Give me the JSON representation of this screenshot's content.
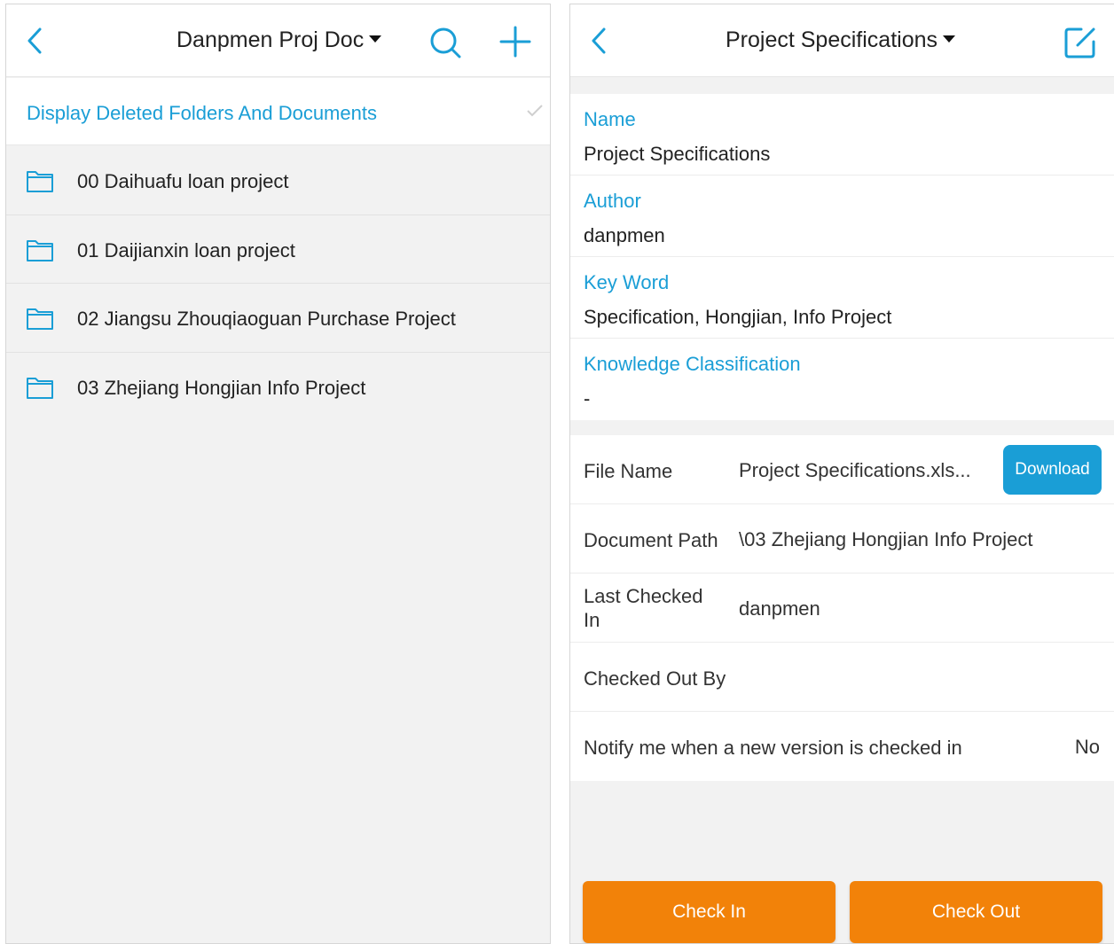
{
  "left": {
    "header": {
      "title": "Danpmen Proj Doc",
      "icons": [
        "back-icon",
        "search-icon",
        "plus-icon",
        "dropdown-caret-icon"
      ]
    },
    "deleted_toggle": {
      "label": "Display Deleted Folders And Documents",
      "icon": "check-icon"
    },
    "folders": [
      {
        "name": "00 Daihuafu loan project"
      },
      {
        "name": "01 Daijianxin loan project"
      },
      {
        "name": "02 Jiangsu Zhouqiaoguan Purchase Project"
      },
      {
        "name": "03 Zhejiang Hongjian Info Project"
      }
    ]
  },
  "right": {
    "header": {
      "title": "Project Specifications",
      "icons": [
        "back-icon",
        "edit-icon",
        "dropdown-caret-icon"
      ]
    },
    "fields": [
      {
        "label": "Name",
        "value": "Project Specifications"
      },
      {
        "label": "Author",
        "value": "danpmen"
      },
      {
        "label": "Key Word",
        "value": "Specification, Hongjian, Info Project"
      },
      {
        "label": "Knowledge Classification",
        "value": "-"
      }
    ],
    "details": {
      "file_name_label": "File Name",
      "file_name_value": "Project Specifications.xls...",
      "download_label": "Download",
      "path_label": "Document Path",
      "path_value": "\\03 Zhejiang Hongjian Info Project",
      "checked_in_label": "Last Checked In",
      "checked_in_value": "danpmen",
      "checked_out_label": "Checked Out By",
      "checked_out_value": "",
      "notify_label": "Notify me when a new version is checked in",
      "notify_value": "No"
    },
    "actions": {
      "check_in": "Check In",
      "check_out": "Check Out"
    }
  },
  "colors": {
    "accent": "#1a9ed6",
    "action": "#f28209",
    "background": "#f2f2f2"
  }
}
